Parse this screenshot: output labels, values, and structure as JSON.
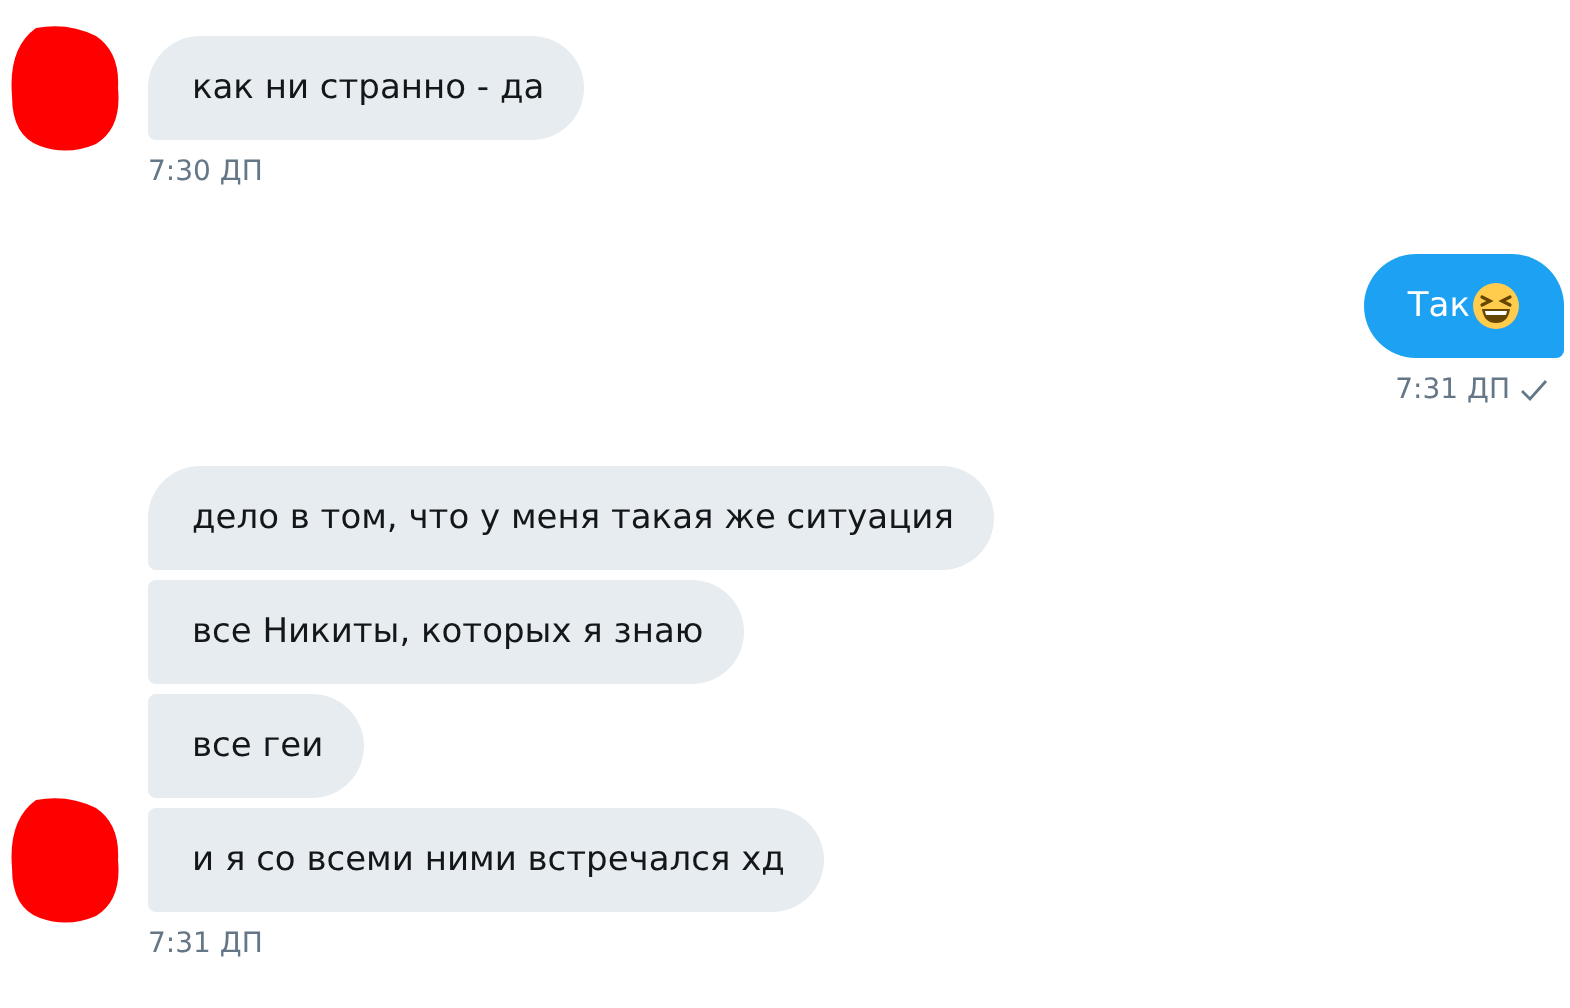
{
  "groups": [
    {
      "kind": "incoming",
      "avatar_redacted": true,
      "messages": [
        {
          "text": "как ни странно - да"
        }
      ],
      "time": "7:30 ДП"
    },
    {
      "kind": "outgoing",
      "messages": [
        {
          "text": "Так",
          "emoji": true
        }
      ],
      "time": "7:31 ДП",
      "seen": true
    },
    {
      "kind": "incoming",
      "avatar_redacted": true,
      "messages": [
        {
          "text": "дело в том, что у меня такая же ситуация"
        },
        {
          "text": "все Никиты, которых я знаю"
        },
        {
          "text": "все геи"
        },
        {
          "text": "и я со всеми ними встречался хд"
        }
      ],
      "time": "7:31 ДП"
    }
  ]
}
